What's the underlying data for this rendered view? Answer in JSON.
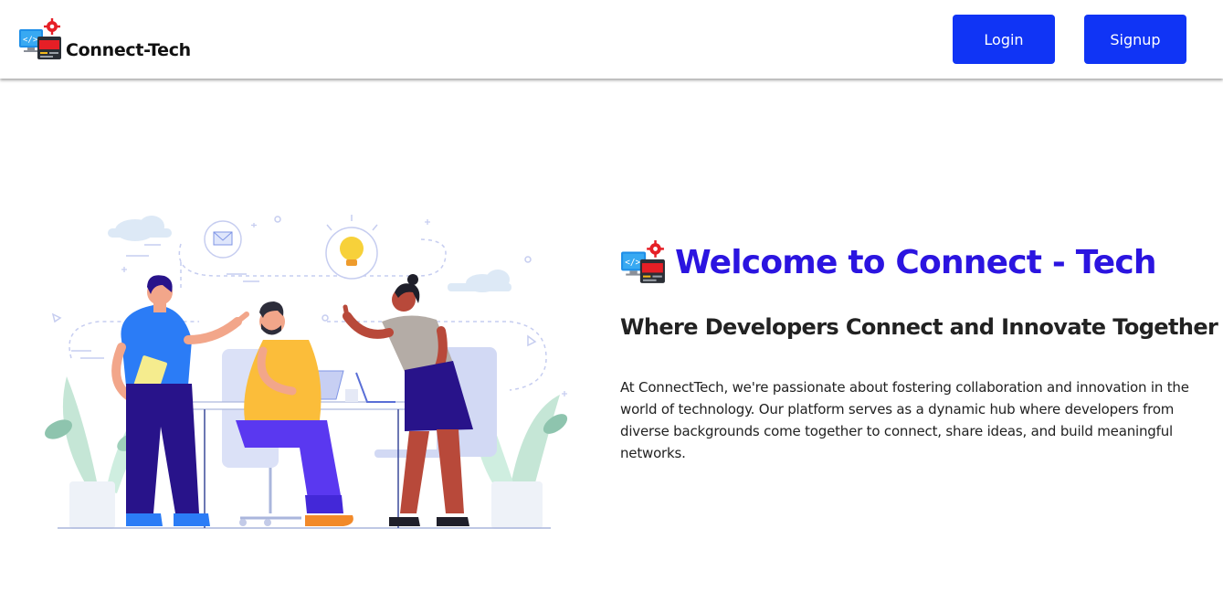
{
  "header": {
    "brand_name": "Connect-Tech",
    "logo_icon": "dev-workstation-icon",
    "login_label": "Login",
    "signup_label": "Signup",
    "button_color": "#1034f5"
  },
  "hero": {
    "illustration": "team-collaboration-illustration",
    "title": "Welcome to Connect - Tech",
    "title_color": "#2b14e0",
    "subtitle": "Where Developers Connect and Innovate Together",
    "description": "At ConnectTech, we're passionate about fostering collaboration and innovation in the world of technology. Our platform serves as a dynamic hub where developers from diverse backgrounds come together to connect, share ideas, and build meaningful networks."
  }
}
